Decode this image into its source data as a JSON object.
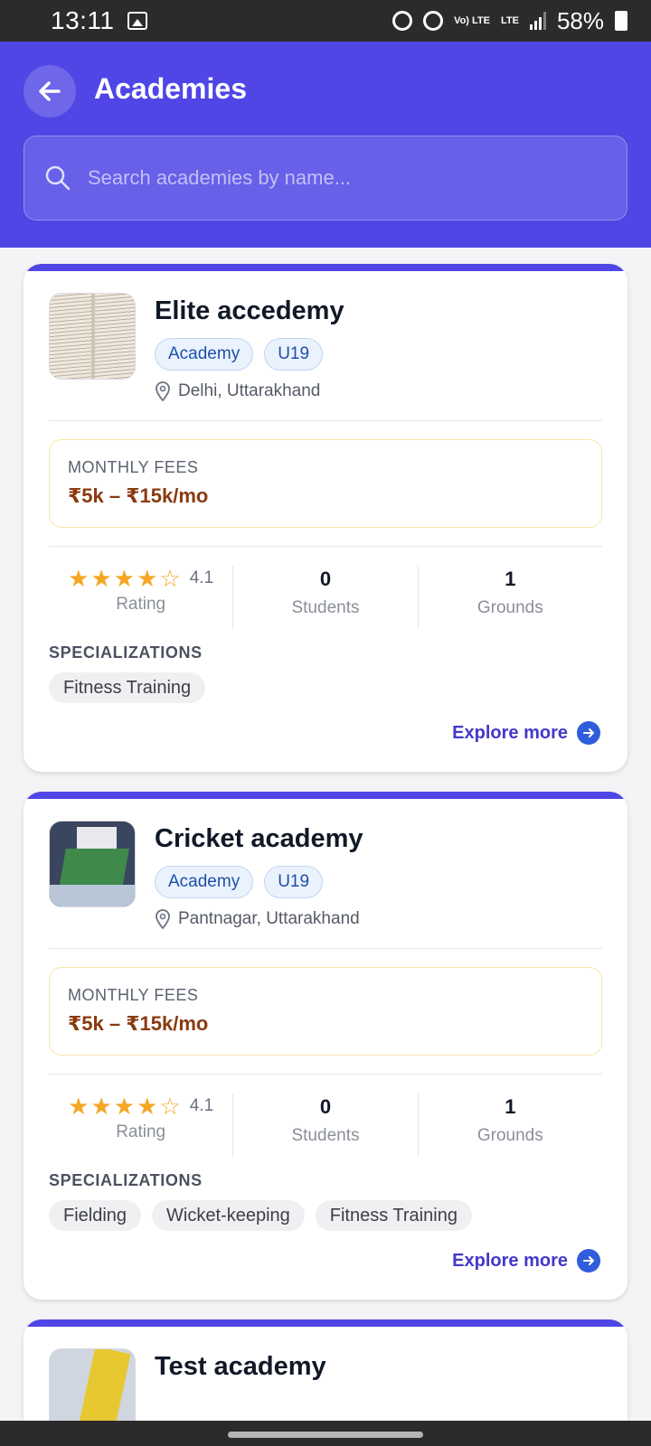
{
  "status_bar": {
    "time": "13:11",
    "battery": "58%",
    "icons": [
      "gallery-icon",
      "alarm-icon",
      "hotspot-icon",
      "volte-icon",
      "lte-icon",
      "signal-icon",
      "battery-icon"
    ],
    "volte_text": "Vo) LTE",
    "lte_text": "LTE"
  },
  "header": {
    "title": "Academies",
    "back_icon": "arrow-left-icon",
    "background": "#4f46e5"
  },
  "search": {
    "placeholder": "Search academies by name...",
    "icon": "search-icon"
  },
  "academies": [
    {
      "name": "Elite accedemy",
      "tags": [
        "Academy",
        "U19"
      ],
      "location": "Delhi, Uttarakhand",
      "fees_label": "MONTHLY FEES",
      "fees_value": "₹5k – ₹15k/mo",
      "rating": "4.1",
      "rating_stars": 4,
      "rating_label": "Rating",
      "students": "0",
      "students_label": "Students",
      "grounds": "1",
      "grounds_label": "Grounds",
      "specializations_title": "SPECIALIZATIONS",
      "specializations": [
        "Fitness Training"
      ],
      "explore": "Explore more"
    },
    {
      "name": "Cricket academy",
      "tags": [
        "Academy",
        "U19"
      ],
      "location": "Pantnagar, Uttarakhand",
      "fees_label": "MONTHLY FEES",
      "fees_value": "₹5k – ₹15k/mo",
      "rating": "4.1",
      "rating_stars": 4,
      "rating_label": "Rating",
      "students": "0",
      "students_label": "Students",
      "grounds": "1",
      "grounds_label": "Grounds",
      "specializations_title": "SPECIALIZATIONS",
      "specializations": [
        "Fielding",
        "Wicket-keeping",
        "Fitness Training"
      ],
      "explore": "Explore more"
    },
    {
      "name": "Test academy"
    }
  ],
  "colors": {
    "accent": "#4f46e5",
    "star": "#f5a623",
    "fees_text": "#8a3a0f",
    "link": "#4338ca"
  }
}
